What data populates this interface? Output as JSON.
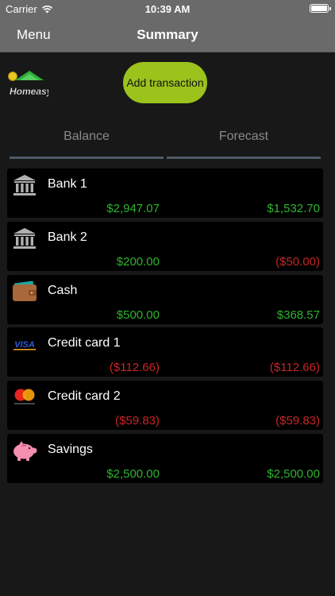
{
  "status": {
    "carrier": "Carrier",
    "time": "10:39 AM"
  },
  "nav": {
    "menu_label": "Menu",
    "title": "Summary"
  },
  "logo": {
    "text": "Homeasy"
  },
  "add_transaction_label": "Add transaction",
  "tabs": [
    {
      "label": "Balance"
    },
    {
      "label": "Forecast"
    }
  ],
  "accounts": [
    {
      "name": "Bank 1",
      "balance": "$2,947.07",
      "forecast": "$1,532.70",
      "icon": "bank-icon"
    },
    {
      "name": "Bank 2",
      "balance": "$200.00",
      "forecast": "($50.00)",
      "icon": "bank-icon"
    },
    {
      "name": "Cash",
      "balance": "$500.00",
      "forecast": "$368.57",
      "icon": "wallet-icon"
    },
    {
      "name": "Credit card 1",
      "balance": "($112.66)",
      "forecast": "($112.66)",
      "icon": "visa-icon"
    },
    {
      "name": "Credit card 2",
      "balance": "($59.83)",
      "forecast": "($59.83)",
      "icon": "mastercard-icon"
    },
    {
      "name": "Savings",
      "balance": "$2,500.00",
      "forecast": "$2,500.00",
      "icon": "piggy-bank-icon"
    }
  ],
  "colors": {
    "positive": "#2fb32f",
    "negative": "#c82525",
    "accent": "#9bc31c",
    "nav_background": "#6a6a6a"
  }
}
